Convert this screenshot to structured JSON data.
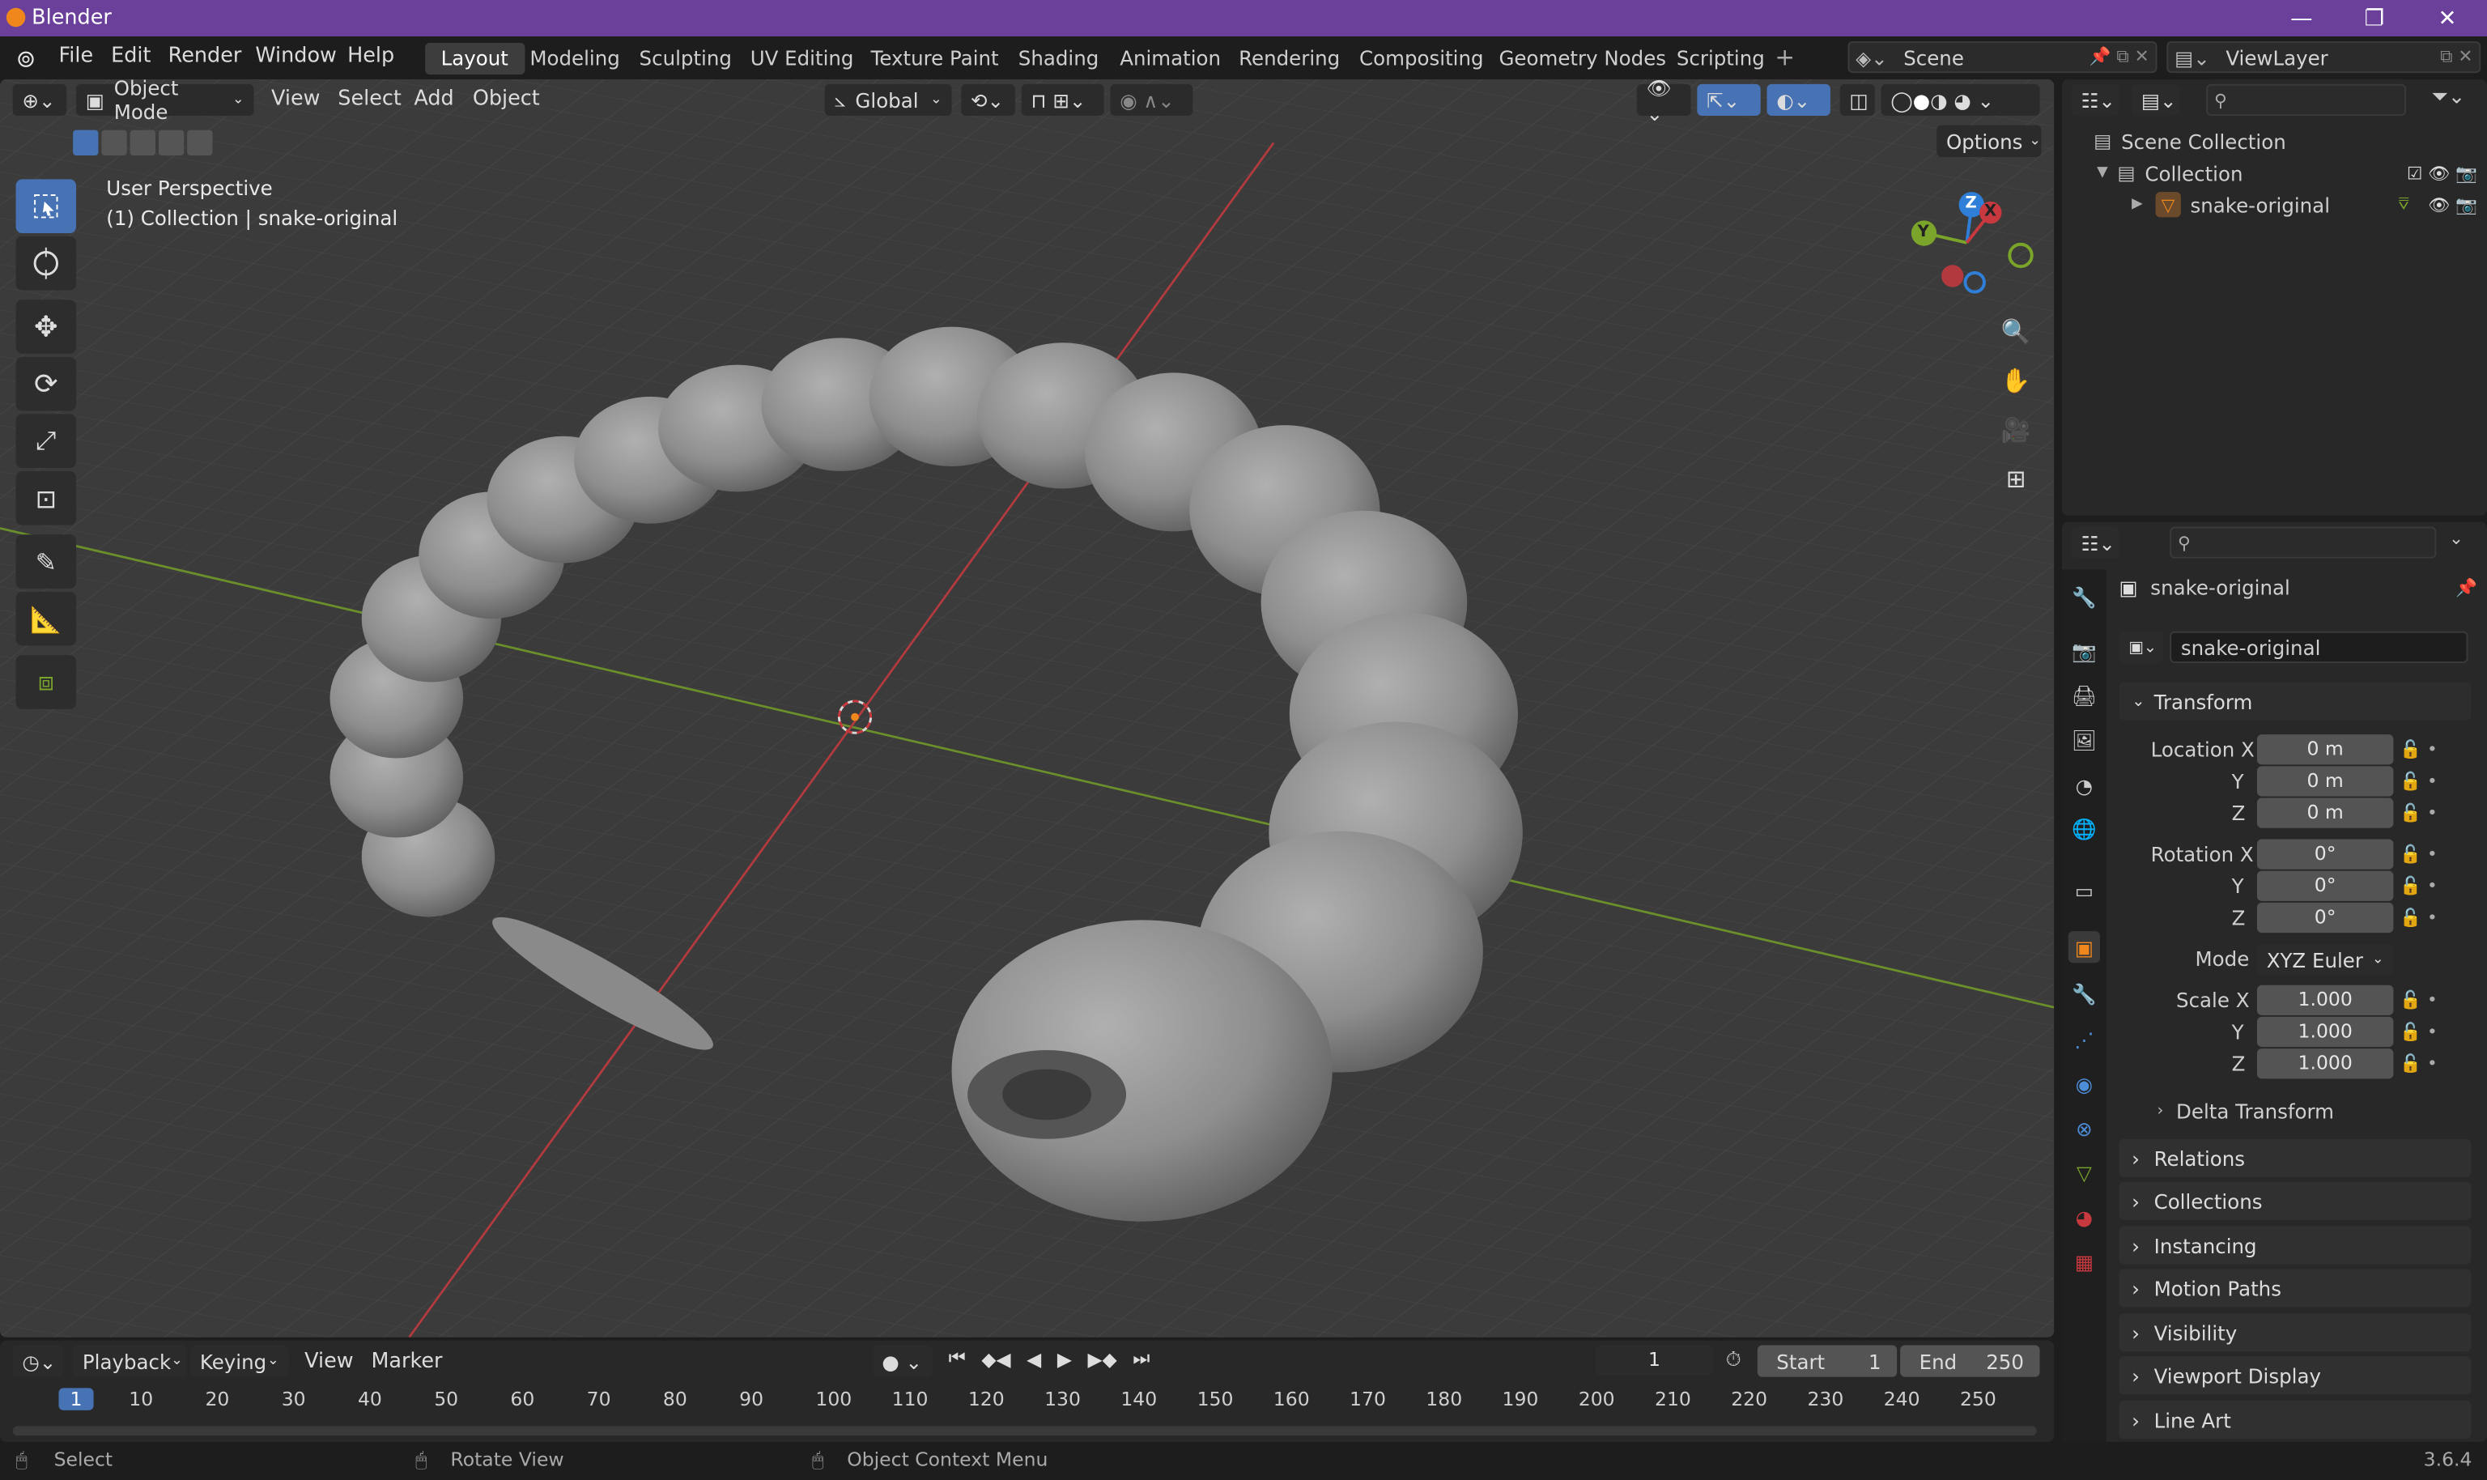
{
  "app": {
    "title": "Blender",
    "version": "3.6.4"
  },
  "menu": [
    "File",
    "Edit",
    "Render",
    "Window",
    "Help"
  ],
  "workspaces": [
    "Layout",
    "Modeling",
    "Sculpting",
    "UV Editing",
    "Texture Paint",
    "Shading",
    "Animation",
    "Rendering",
    "Compositing",
    "Geometry Nodes",
    "Scripting"
  ],
  "active_workspace": "Layout",
  "scene": "Scene",
  "view_layer": "ViewLayer",
  "viewport": {
    "mode": "Object Mode",
    "menus": [
      "View",
      "Select",
      "Add",
      "Object"
    ],
    "orientation": "Global",
    "options": "Options",
    "perspective": "User Perspective",
    "context": "(1) Collection | snake-original",
    "gizmo": {
      "z": "Z",
      "y": "Y",
      "x": "X"
    }
  },
  "outliner": {
    "root": "Scene Collection",
    "collection": "Collection",
    "object": "snake-original"
  },
  "properties": {
    "object_name": "snake-original",
    "data_name": "snake-original",
    "transform": {
      "header": "Transform",
      "location_label": "Location X",
      "rotation_label": "Rotation X",
      "scale_label": "Scale X",
      "y": "Y",
      "z": "Z",
      "location": [
        "0 m",
        "0 m",
        "0 m"
      ],
      "rotation": [
        "0°",
        "0°",
        "0°"
      ],
      "mode_label": "Mode",
      "mode": "XYZ Euler",
      "scale": [
        "1.000",
        "1.000",
        "1.000"
      ],
      "delta": "Delta Transform"
    },
    "panels": [
      "Relations",
      "Collections",
      "Instancing",
      "Motion Paths",
      "Visibility",
      "Viewport Display",
      "Line Art"
    ]
  },
  "timeline": {
    "menus": [
      "Playback",
      "Keying",
      "View",
      "Marker"
    ],
    "current_frame": "1",
    "start_label": "Start",
    "start": "1",
    "end_label": "End",
    "end": "250",
    "ticks": [
      "1",
      "10",
      "20",
      "30",
      "40",
      "50",
      "60",
      "70",
      "80",
      "90",
      "100",
      "110",
      "120",
      "130",
      "140",
      "150",
      "160",
      "170",
      "180",
      "190",
      "200",
      "210",
      "220",
      "230",
      "240",
      "250"
    ]
  },
  "status": {
    "select": "Select",
    "rotate": "Rotate View",
    "context_menu": "Object Context Menu"
  },
  "colors": {
    "title_bar": "#6a409b",
    "active_tool": "#4772b3",
    "x_axis": "#c8393f",
    "y_axis": "#7ba42a",
    "z_axis": "#2f7fd8",
    "object_orange": "#f0871d"
  }
}
